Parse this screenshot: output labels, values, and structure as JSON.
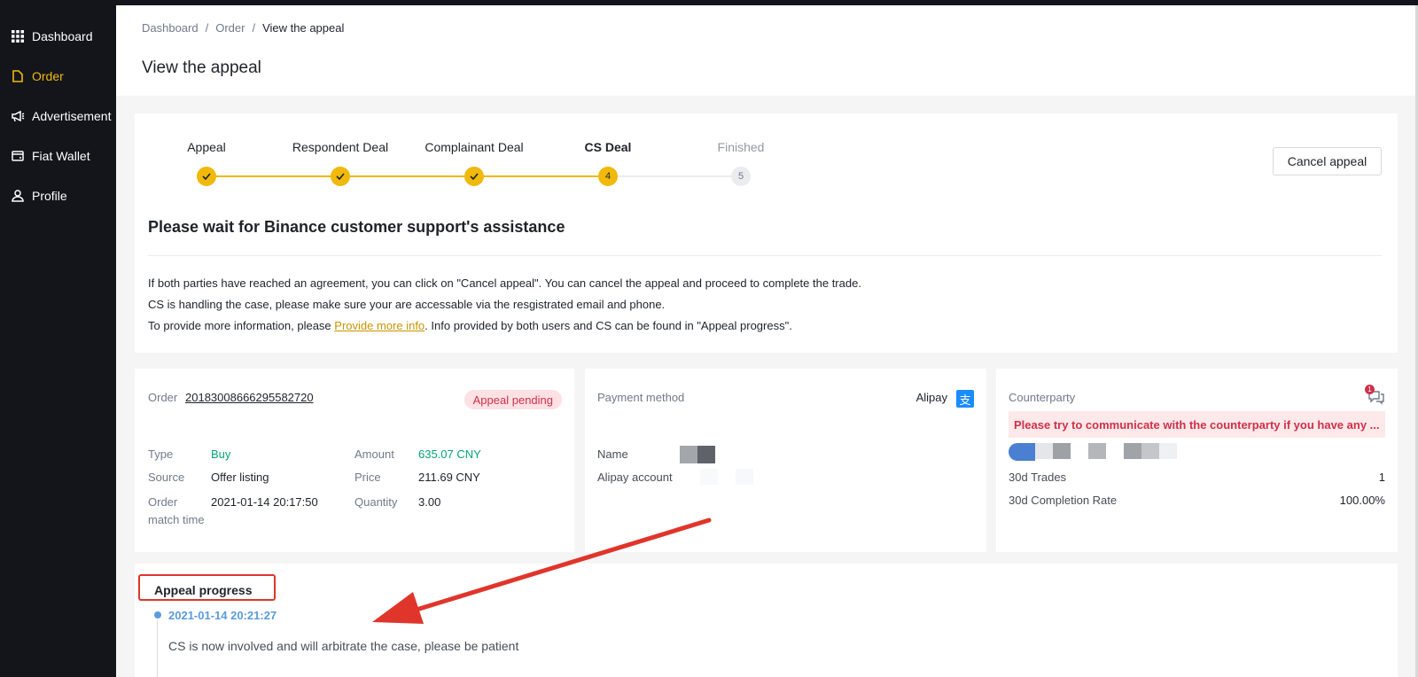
{
  "sidebar": {
    "items": [
      {
        "label": "Dashboard",
        "icon": "grid-icon",
        "active": false
      },
      {
        "label": "Order",
        "icon": "document-icon",
        "active": true
      },
      {
        "label": "Advertisement",
        "icon": "megaphone-icon",
        "active": false
      },
      {
        "label": "Fiat Wallet",
        "icon": "wallet-icon",
        "active": false
      },
      {
        "label": "Profile",
        "icon": "person-icon",
        "active": false
      }
    ]
  },
  "breadcrumb": {
    "items": [
      "Dashboard",
      "Order",
      "View the appeal"
    ],
    "separator": "/"
  },
  "page": {
    "title": "View the appeal"
  },
  "steps": [
    {
      "label": "Appeal",
      "state": "done"
    },
    {
      "label": "Respondent Deal",
      "state": "done"
    },
    {
      "label": "Complainant Deal",
      "state": "done"
    },
    {
      "label": "CS Deal",
      "state": "current",
      "number": "4"
    },
    {
      "label": "Finished",
      "state": "future",
      "number": "5"
    }
  ],
  "cancel_button": "Cancel appeal",
  "status": {
    "title": "Please wait for Binance customer support's assistance",
    "line1": "If both parties have reached an agreement, you can click on \"Cancel appeal\". You can cancel the appeal and proceed to complete the trade.",
    "line2": "CS is handling the case, please make sure your are accessable via the resgistrated email and phone.",
    "line3_prefix": "To provide more information, please ",
    "line3_link": "Provide more info",
    "line3_suffix": ". Info provided by both users and CS can be found in \"Appeal progress\"."
  },
  "order_card": {
    "order_label": "Order",
    "order_number": "20183008666295582720",
    "badge": "Appeal pending",
    "type_label": "Type",
    "type_value": "Buy",
    "source_label": "Source",
    "source_value": "Offer listing",
    "match_label_1": "Order",
    "match_label_2": "match time",
    "match_value": "2021-01-14 20:17:50",
    "amount_label": "Amount",
    "amount_value": "635.07 CNY",
    "price_label": "Price",
    "price_value": "211.69 CNY",
    "quantity_label": "Quantity",
    "quantity_value": "3.00"
  },
  "payment_card": {
    "label": "Payment method",
    "method": "Alipay",
    "icon_glyph": "支",
    "name_label": "Name",
    "account_label": "Alipay account"
  },
  "counterparty_card": {
    "label": "Counterparty",
    "chat_badge": "1",
    "tooltip": "Please try to communicate with the counterparty if you have any ...",
    "trades_label": "30d Trades",
    "trades_value": "1",
    "completion_label": "30d Completion Rate",
    "completion_value": "100.00%"
  },
  "appeal_progress": {
    "title": "Appeal progress",
    "entries": [
      {
        "time": "2021-01-14 20:21:27",
        "text": "CS is now involved and will arbitrate the case, please be patient"
      }
    ]
  },
  "colors": {
    "accent": "#f0b90b",
    "sidebar_bg": "#14151a",
    "danger": "#cf304a",
    "buy_green": "#03a66d",
    "annotation_red": "#e0352b"
  }
}
